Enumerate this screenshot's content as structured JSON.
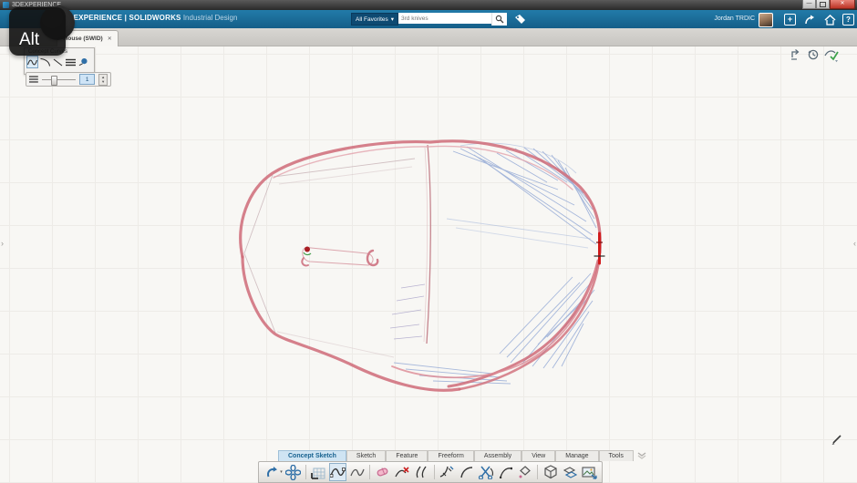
{
  "window": {
    "title": "3DEXPERIENCE"
  },
  "top_bar": {
    "brand": "3DEXPERIENCE | SOLIDWORKS",
    "edition": "Industrial Design",
    "search_scope": "All Favorites",
    "search_placeholder": "3rd knives",
    "user_name": "Jordan TRDIC"
  },
  "doc_tab": {
    "label": "Mouse (SWID)",
    "close_glyph": "✕"
  },
  "overlay": {
    "key_label": "Alt"
  },
  "concept_curves_panel": {
    "title": "Concept Curves",
    "tools": [
      "spline-tool",
      "arc-tool",
      "line-tool",
      "style-list-tool",
      "point-tool"
    ]
  },
  "style_bar": {
    "value": "1"
  },
  "canvas_icons": [
    "refresh-icon",
    "history-icon",
    "approve-icon"
  ],
  "bottom_bar": {
    "tabs": [
      {
        "label": "Concept Sketch",
        "active": true
      },
      {
        "label": "Sketch",
        "active": false
      },
      {
        "label": "Feature",
        "active": false
      },
      {
        "label": "Freeform",
        "active": false
      },
      {
        "label": "Assembly",
        "active": false
      },
      {
        "label": "View",
        "active": false
      },
      {
        "label": "Manage",
        "active": false
      },
      {
        "label": "Tools",
        "active": false
      }
    ],
    "icons": [
      "undo",
      "compass",
      "sketch-grid",
      "spline",
      "freehand-spline",
      "eraser",
      "trim",
      "offset-curve",
      "blend-curve",
      "fillet-arc",
      "split",
      "arc",
      "control-point",
      "cube",
      "planes",
      "insert-image"
    ]
  },
  "glyphs": {
    "minimize": "—",
    "close_window": "✕",
    "plus": "+",
    "question": "?",
    "chevron_down": "▾",
    "left_expander": "›",
    "right_expander": "‹"
  }
}
